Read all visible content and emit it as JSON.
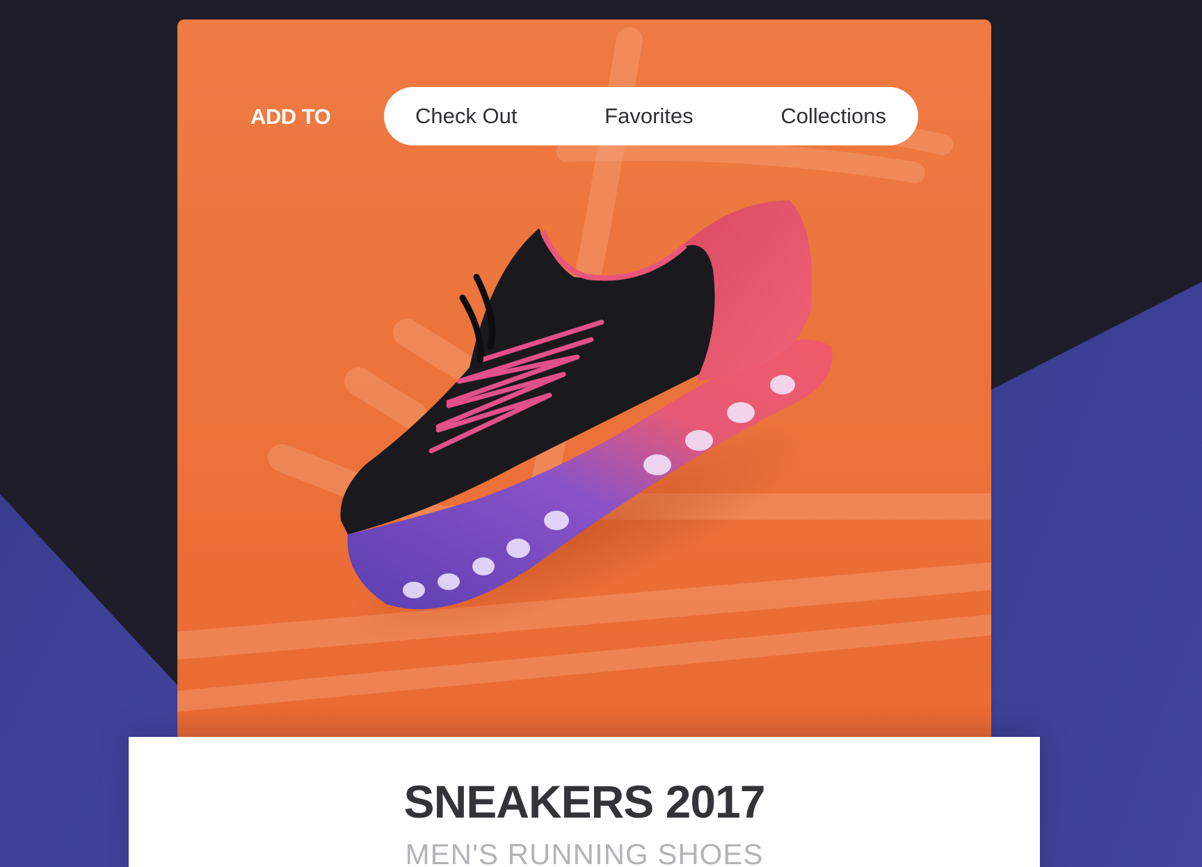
{
  "add_to": {
    "label": "ADD TO",
    "options": [
      "Check Out",
      "Favorites",
      "Collections"
    ]
  },
  "product": {
    "title": "SNEAKERS 2017",
    "subtitle": "MEN'S RUNNING SHOES"
  },
  "colors": {
    "background_dark": "#1e1e2b",
    "background_purple": "#3c3f96",
    "card_orange": "#ec723b",
    "pill_white": "#ffffff",
    "title_text": "#333338",
    "subtitle_text": "#b3b3b8"
  }
}
